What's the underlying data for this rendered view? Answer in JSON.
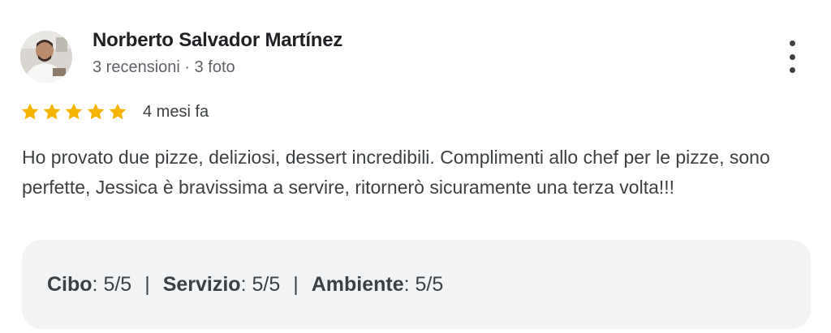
{
  "review": {
    "author": {
      "name": "Norberto Salvador Martínez",
      "meta": "3 recensioni · 3 foto"
    },
    "rating": 5,
    "rating_max": 5,
    "time_ago": "4 mesi fa",
    "text": "Ho provato due pizze, deliziosi, dessert incredibili. Complimenti allo chef per le pizze, sono perfette, Jessica è bravissima a servire, ritornerò sicuramente una terza volta!!!",
    "sub_ratings": [
      {
        "label": "Cibo",
        "value": ": 5/5"
      },
      {
        "label": "Servizio",
        "value": ": 5/5"
      },
      {
        "label": "Ambiente",
        "value": ": 5/5"
      }
    ],
    "separator": "|"
  },
  "icons": {
    "avatar": "avatar-photo",
    "more": "more-vert-icon",
    "star": "star-icon"
  },
  "colors": {
    "star": "#f4b400",
    "panel_bg": "#f1f3f4",
    "text": "#3c4043"
  }
}
